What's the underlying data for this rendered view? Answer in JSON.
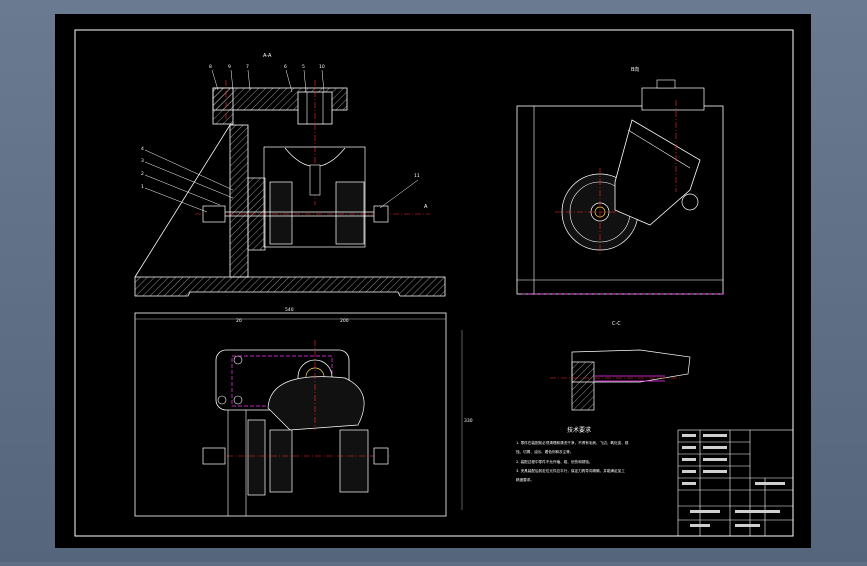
{
  "colors": {
    "viewport_bg": "#5f6f86",
    "paper": "#000000",
    "line": "#ffffff",
    "hatch": "#cfcfcf",
    "center_line": "#ff2a2a",
    "hidden_line": "#ff33ff",
    "dim_line": "#b8b8b8"
  },
  "labels": {
    "section_aa": "A-A",
    "view_b": "B向",
    "view_c": "C-C",
    "marker_a": "A",
    "tech_req_title": "技术要求"
  },
  "tech_requirements": [
    "1. 零件在装配前必须清理和清洗干净，不得有毛刺、飞边、氧化皮、锈",
    "蚀、切屑、油污、着色剂和灰尘等。",
    "2. 装配过程中零件不允许磕、碰、划伤和锈蚀。",
    "3. 夹具装配后其定位元件应平行，保证刀具导向精确，并能满足加工",
    "精度要求。"
  ],
  "part_numbers_top": [
    "8",
    "9",
    "7",
    "6",
    "5",
    "10"
  ],
  "part_numbers_left": [
    "4",
    "3",
    "2",
    "1"
  ],
  "part_number_right": "11",
  "dimensions": {
    "overall_width": "540",
    "left_offset": "20",
    "right_span": "200",
    "height": "330"
  }
}
